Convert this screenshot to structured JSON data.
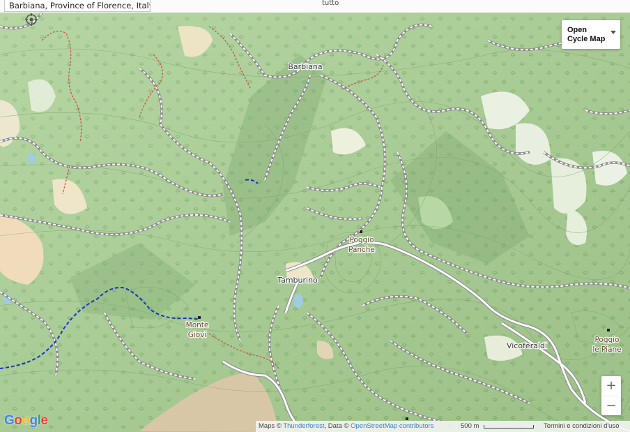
{
  "search": {
    "address": "Barbiana, Province of Florence, Italy"
  },
  "top_bar": {
    "link": "tutto"
  },
  "map": {
    "map_type_label": "Open Cycle Map",
    "places": [
      {
        "id": "barbiana",
        "label": "Barbiana",
        "kind": "village"
      },
      {
        "id": "poggio-panche",
        "label": "Poggio Panche",
        "kind": "peak"
      },
      {
        "id": "tamburino",
        "label": "Tamburino",
        "kind": "village"
      },
      {
        "id": "monte-giovi",
        "label": "Monte Giovi",
        "kind": "peak"
      },
      {
        "id": "vicoferaldi",
        "label": "Vicoferaldi",
        "kind": "village"
      },
      {
        "id": "poggio-le-piane",
        "label": "Poggio le Piane",
        "kind": "peak"
      }
    ],
    "colors": {
      "forest": "#a9cf93",
      "forest_dark": "#8fbb7a",
      "clearing": "#e8eedd",
      "bare_rock": "#d9c9a9",
      "road": "#ffffff",
      "road_casing": "#8a8a8a",
      "cycle_route": "#1633c9",
      "trail": "#c05a4a"
    }
  },
  "zoom": {
    "in": "+",
    "out": "−"
  },
  "branding": {
    "logo": "Google"
  },
  "attribution": {
    "prefix": "Maps © ",
    "tiles": "Thunderforest",
    "data_prefix": ", Data © ",
    "data": "OpenStreetMap contributors",
    "scale": "500 m",
    "terms": "Termini e condizioni d'uso"
  }
}
